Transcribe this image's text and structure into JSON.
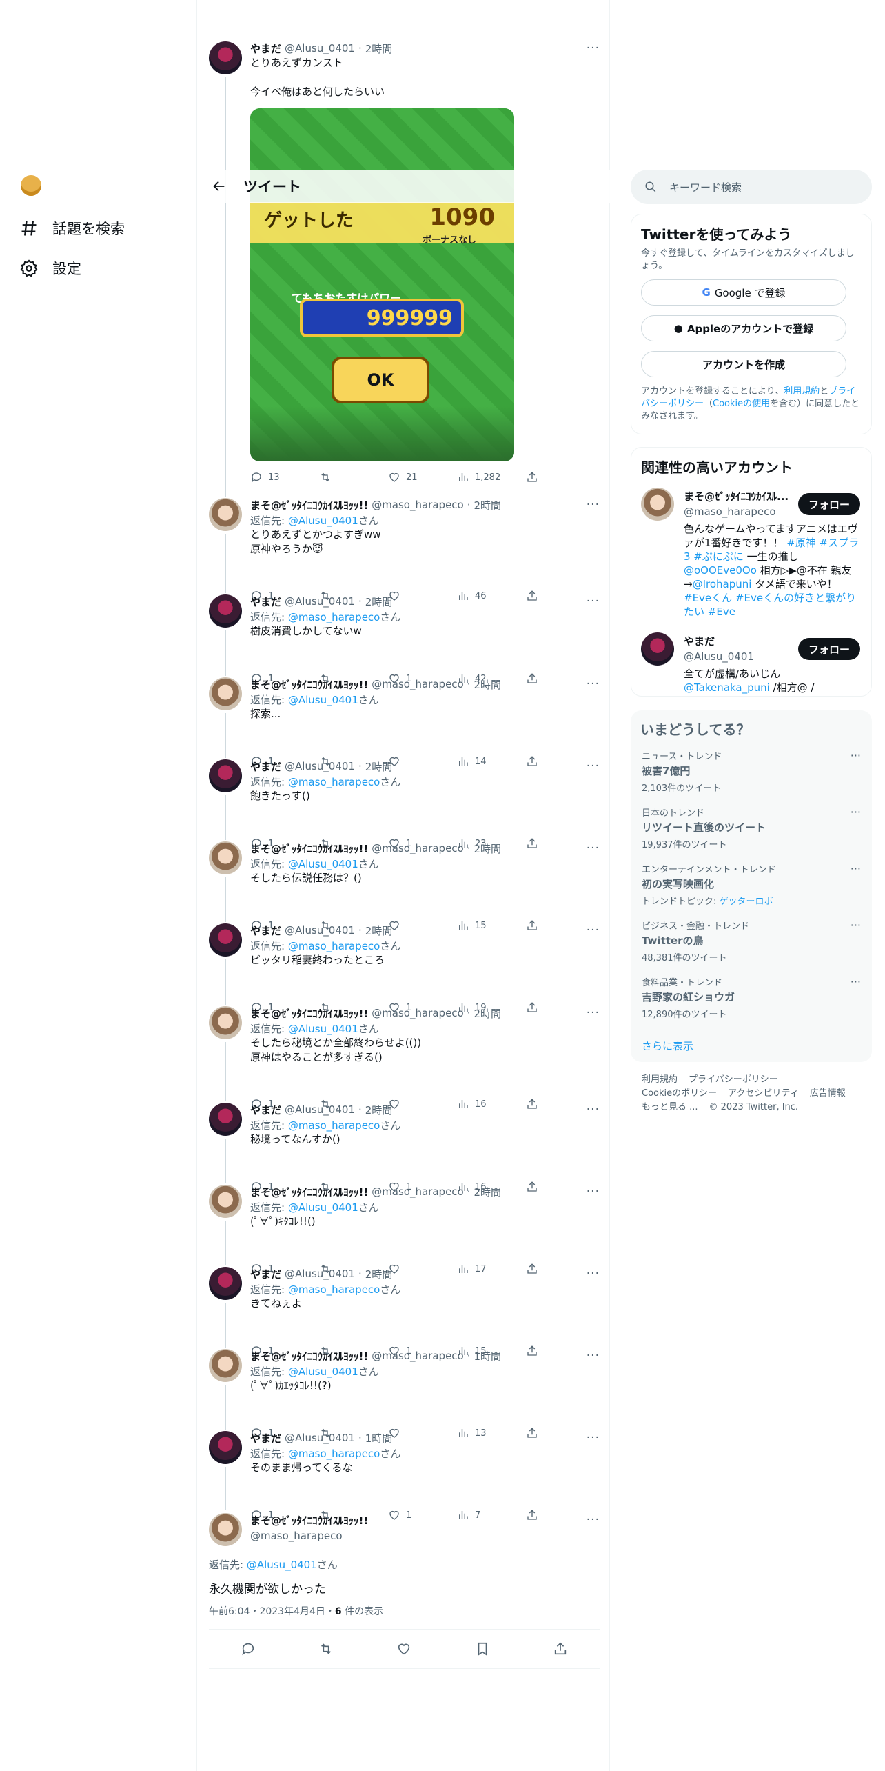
{
  "nav": {
    "items": [
      {
        "label": "話題を検索"
      },
      {
        "label": "設定"
      }
    ]
  },
  "header": {
    "title": "ツイート"
  },
  "tweets": [
    {
      "name": "やまだ",
      "handle": "@Alusu_0401",
      "time": "2時間",
      "reply_to": "",
      "text": "とりあえずカンスト\n\n今イベ俺はあと何したらいい",
      "replies": "13",
      "retweets": "",
      "likes": "21",
      "views": "1,282"
    },
    {
      "name": "まそ@ｾﾞｯﾀｲﾆｺｳｶｲｽﾙﾖｯｯ!!",
      "handle": "@maso_harapeco",
      "time": "2時間",
      "reply_to": "@Alusu_0401",
      "text": "とりあえずとかつよすぎww\n原神やろうか😇",
      "replies": "1",
      "retweets": "",
      "likes": "",
      "views": "46"
    },
    {
      "name": "やまだ",
      "handle": "@Alusu_0401",
      "time": "2時間",
      "reply_to": "@maso_harapeco",
      "text": "樹皮消費しかしてないw",
      "replies": "1",
      "retweets": "",
      "likes": "1",
      "views": "42"
    },
    {
      "name": "まそ@ｾﾞｯﾀｲﾆｺｳｶｲｽﾙﾖｯｯ!!",
      "handle": "@maso_harapeco",
      "time": "2時間",
      "reply_to": "@Alusu_0401",
      "text": "探索...",
      "replies": "1",
      "retweets": "",
      "likes": "",
      "views": "14"
    },
    {
      "name": "やまだ",
      "handle": "@Alusu_0401",
      "time": "2時間",
      "reply_to": "@maso_harapeco",
      "text": "飽きたっす()",
      "replies": "1",
      "retweets": "",
      "likes": "1",
      "views": "23"
    },
    {
      "name": "まそ@ｾﾞｯﾀｲﾆｺｳｶｲｽﾙﾖｯｯ!!",
      "handle": "@maso_harapeco",
      "time": "2時間",
      "reply_to": "@Alusu_0401",
      "text": "そしたら伝説任務は？()",
      "replies": "1",
      "retweets": "",
      "likes": "",
      "views": "15"
    },
    {
      "name": "やまだ",
      "handle": "@Alusu_0401",
      "time": "2時間",
      "reply_to": "@maso_harapeco",
      "text": "ピッタリ稲妻終わったところ",
      "replies": "1",
      "retweets": "",
      "likes": "1",
      "views": "19"
    },
    {
      "name": "まそ@ｾﾞｯﾀｲﾆｺｳｶｲｽﾙﾖｯｯ!!",
      "handle": "@maso_harapeco",
      "time": "2時間",
      "reply_to": "@Alusu_0401",
      "text": "そしたら秘境とか全部終わらせよ(())\n原神はやることが多すぎる()",
      "replies": "1",
      "retweets": "",
      "likes": "",
      "views": "16"
    },
    {
      "name": "やまだ",
      "handle": "@Alusu_0401",
      "time": "2時間",
      "reply_to": "@maso_harapeco",
      "text": "秘境ってなんすか()",
      "replies": "1",
      "retweets": "",
      "likes": "1",
      "views": "16"
    },
    {
      "name": "まそ@ｾﾞｯﾀｲﾆｺｳｶｲｽﾙﾖｯｯ!!",
      "handle": "@maso_harapeco",
      "time": "2時間",
      "reply_to": "@Alusu_0401",
      "text": "(ﾟ∀ﾟ)ｷﾀｺﾚ!!()",
      "replies": "1",
      "retweets": "",
      "likes": "",
      "views": "17"
    },
    {
      "name": "やまだ",
      "handle": "@Alusu_0401",
      "time": "2時間",
      "reply_to": "@maso_harapeco",
      "text": "きてねぇよ",
      "replies": "1",
      "retweets": "",
      "likes": "1",
      "views": "15"
    },
    {
      "name": "まそ@ｾﾞｯﾀｲﾆｺｳｶｲｽﾙﾖｯｯ!!",
      "handle": "@maso_harapeco",
      "time": "1時間",
      "reply_to": "@Alusu_0401",
      "text": "(ﾟ∀ﾟ)ｶｴｯﾀｺﾚ!!(?)",
      "replies": "1",
      "retweets": "",
      "likes": "",
      "views": "13"
    },
    {
      "name": "やまだ",
      "handle": "@Alusu_0401",
      "time": "1時間",
      "reply_to": "@maso_harapeco",
      "text": "そのまま帰ってくるな",
      "replies": "1",
      "retweets": "",
      "likes": "1",
      "views": "7"
    }
  ],
  "reply_prefix": "返信先: ",
  "reply_suffix": "さん",
  "main": {
    "name": "まそ@ｾﾞｯﾀｲﾆｺｳｶｲｽﾙﾖｯｯ!!",
    "handle": "@maso_harapeco",
    "reply_prefix": "返信先: ",
    "reply_to": "@Alusu_0401",
    "reply_suffix": "さん",
    "text": "永久機関が欲しかった",
    "time": "午前6:04・2023年4月4日・",
    "views": "6",
    "views_suffix": " 件の表示"
  },
  "media_game": {
    "banner": "ゲットした",
    "score": "1090",
    "bonus": "ボーナスなし",
    "power_label": "てもちおたすけパワー",
    "power": "999999",
    "ok": "OK"
  },
  "search": {
    "placeholder": "キーワード検索"
  },
  "signup": {
    "title": "Twitterを使ってみよう",
    "subtitle": "今すぐ登録して、タイムラインをカスタマイズしましょう。",
    "google": "Google で登録",
    "apple": "Appleのアカウントで登録",
    "create": "アカウントを作成",
    "legal_1": "アカウントを登録することにより、",
    "terms": "利用規約",
    "legal_2": "と",
    "privacy": "プライバシーポリシー",
    "legal_3": "（",
    "cookie": "Cookieの使用",
    "legal_4": "を含む）に同意したとみなされます。"
  },
  "related": {
    "title": "関連性の高いアカウント",
    "accounts": [
      {
        "name": "まそ@ｾﾞｯﾀｲﾆｺｳｶｲｽﾙ...",
        "handle": "@maso_harapeco",
        "follow": "フォロー",
        "bio": [
          [
            "色んなゲームやってますアニメはエヴァが1番好きです！！ ",
            ""
          ],
          [
            "#原神 #スプラ3 #ぷにぷに",
            "blue"
          ],
          [
            " 一生の推し ",
            ""
          ],
          [
            "@oOOEve0Oo",
            "blue"
          ],
          [
            " 相方▷▶@不在 親友→",
            ""
          ],
          [
            "@Irohapuni",
            "blue"
          ],
          [
            " タメ語で来いや！ ",
            ""
          ],
          [
            "#Eveくん #Eveくんの好きと繋がりたい #Eve",
            "blue"
          ]
        ]
      },
      {
        "name": "やまだ",
        "handle": "@Alusu_0401",
        "follow": "フォロー",
        "bio": [
          [
            "全てが虚構/あいじん",
            ""
          ],
          [
            "@Takenaka_puni",
            "blue"
          ],
          [
            " /相方@ /",
            ""
          ]
        ]
      }
    ]
  },
  "trends": {
    "title": "いまどうしてる？",
    "items": [
      {
        "cat": "ニュース・トレンド",
        "title": "被害7億円",
        "count": "2,103件のツイート"
      },
      {
        "cat": "日本のトレンド",
        "title": "リツイート直後のツイート",
        "count": "19,937件のツイート"
      },
      {
        "cat": "エンターテインメント・トレンド",
        "title": "初の実写映画化",
        "count": "トレンドトピック: ",
        "count_link": "ゲッターロボ"
      },
      {
        "cat": "ビジネス・金融・トレンド",
        "title": "Twitterの鳥",
        "count": "48,381件のツイート"
      },
      {
        "cat": "食料品業・トレンド",
        "title": "吉野家の紅ショウガ",
        "count": "12,890件のツイート"
      }
    ],
    "more": "さらに表示"
  },
  "footer": {
    "links": [
      "利用規約",
      "プライバシーポリシー",
      "Cookieのポリシー",
      "アクセシビリティ",
      "広告情報",
      "もっと見る ...",
      "© 2023 Twitter, Inc."
    ]
  }
}
